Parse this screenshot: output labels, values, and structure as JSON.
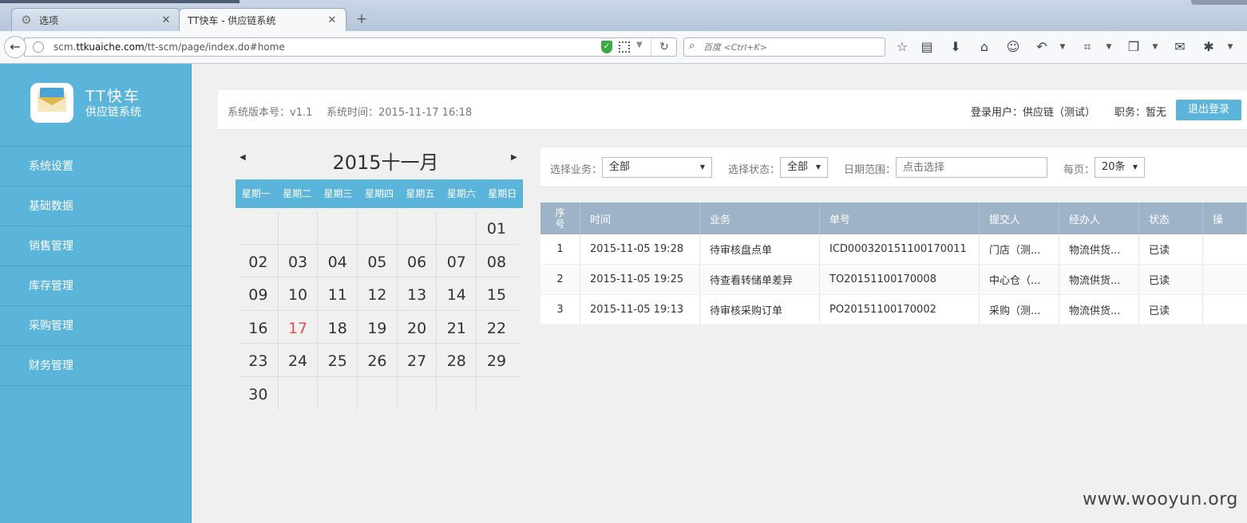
{
  "browser": {
    "tabs": [
      {
        "title": "选项"
      },
      {
        "title": "TT快车 - 供应链系统"
      }
    ],
    "url_prefix": "scm.",
    "url_domain": "ttkuaiche.com",
    "url_path": "/tt-scm/page/index.do#home",
    "search_placeholder": "百度 <Ctrl+K>"
  },
  "brand": {
    "name": "TT快车",
    "subtitle": "供应链系统"
  },
  "menu": [
    {
      "label": "系统设置"
    },
    {
      "label": "基础数据"
    },
    {
      "label": "销售管理"
    },
    {
      "label": "库存管理"
    },
    {
      "label": "采购管理"
    },
    {
      "label": "财务管理"
    }
  ],
  "header": {
    "version": "系统版本号：v1.1",
    "time": "系统时间：2015-11-17 16:18",
    "user": "登录用户：供应链（测试）",
    "role": "职务：暂无",
    "logout": "退出登录"
  },
  "calendar": {
    "title": "2015十一月",
    "weekdays": [
      "星期一",
      "星期二",
      "星期三",
      "星期四",
      "星期五",
      "星期六",
      "星期日"
    ],
    "weeks": [
      [
        "",
        "",
        "",
        "",
        "",
        "",
        "01"
      ],
      [
        "02",
        "03",
        "04",
        "05",
        "06",
        "07",
        "08"
      ],
      [
        "09",
        "10",
        "11",
        "12",
        "13",
        "14",
        "15"
      ],
      [
        "16",
        "17",
        "18",
        "19",
        "20",
        "21",
        "22"
      ],
      [
        "23",
        "24",
        "25",
        "26",
        "27",
        "28",
        "29"
      ],
      [
        "30",
        "",
        "",
        "",
        "",
        "",
        ""
      ]
    ],
    "today": "17",
    "today_color": "#d9534f"
  },
  "filters": {
    "business_label": "选择业务：",
    "business_value": "全部",
    "status_label": "选择状态：",
    "status_value": "全部",
    "date_label": "日期范围：",
    "date_placeholder": "点击选择",
    "page_label": "每页：",
    "page_value": "20条"
  },
  "table": {
    "columns": [
      "序号",
      "时间",
      "业务",
      "单号",
      "提交人",
      "经办人",
      "状态",
      "操"
    ],
    "rows": [
      [
        "1",
        "2015-11-05 19:28",
        "待审核盘点单",
        "ICD000320151100170011",
        "门店（测...",
        "物流供货...",
        "已读",
        ""
      ],
      [
        "2",
        "2015-11-05 19:25",
        "待查看转储单差异",
        "TO20151100170008",
        "中心仓（...",
        "物流供货...",
        "已读",
        ""
      ],
      [
        "3",
        "2015-11-05 19:13",
        "待审核采购订单",
        "PO20151100170002",
        "采购（测...",
        "物流供货...",
        "已读",
        ""
      ]
    ]
  },
  "watermark": "www.wooyun.org",
  "colors": {
    "sidebar": "#5bb4da",
    "table_header": "#9fb3c8",
    "accent": "#5bb4da"
  }
}
